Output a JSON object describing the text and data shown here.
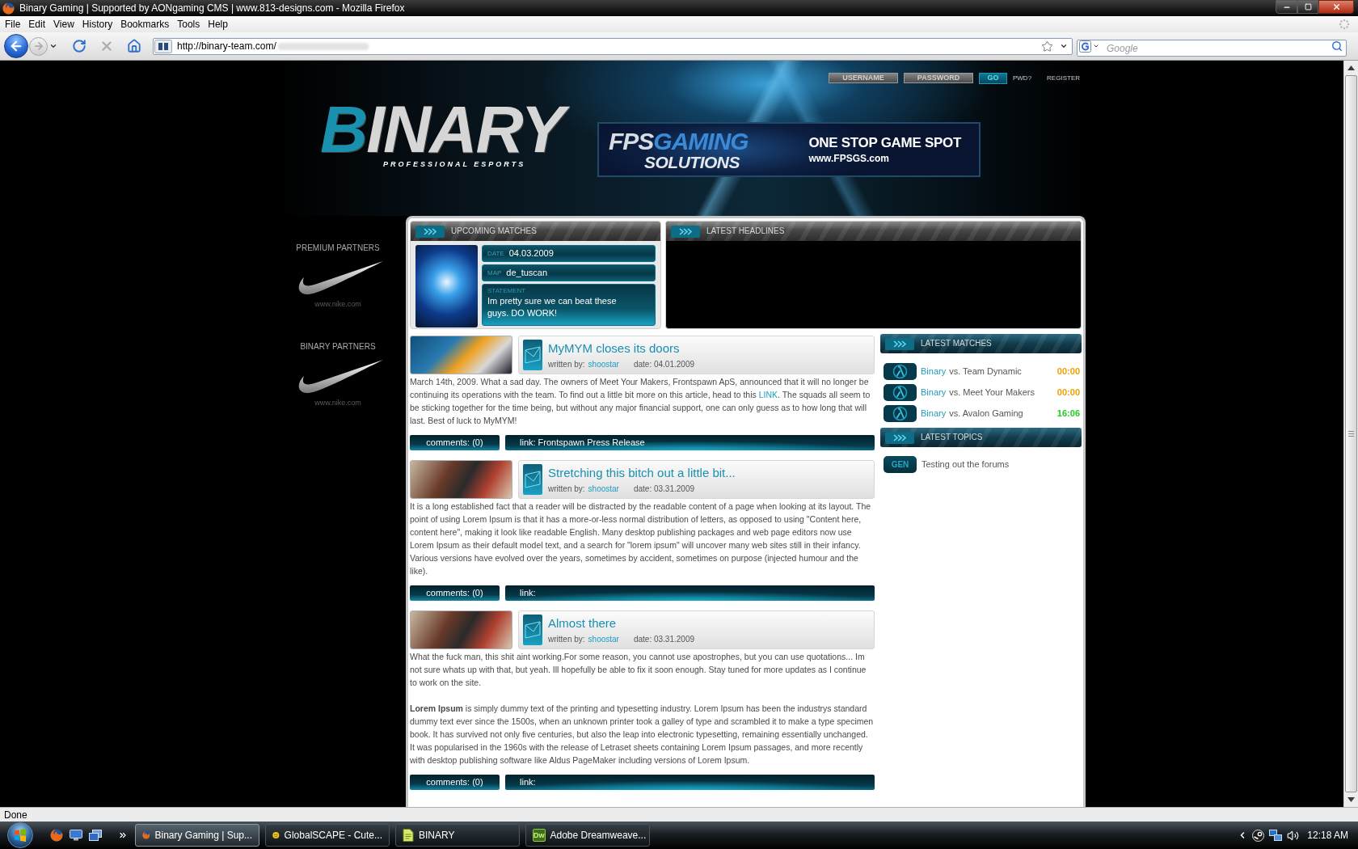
{
  "window": {
    "title": "Binary Gaming | Supported by AONgaming CMS | www.813-designs.com - Mozilla Firefox"
  },
  "menu": [
    "File",
    "Edit",
    "View",
    "History",
    "Bookmarks",
    "Tools",
    "Help"
  ],
  "nav_buttons": [
    {
      "kind": "back",
      "disabled": false
    },
    {
      "kind": "forward",
      "disabled": true
    },
    {
      "kind": "reload",
      "disabled": false
    },
    {
      "kind": "stop",
      "disabled": true
    },
    {
      "kind": "home",
      "disabled": false
    }
  ],
  "address_bar": {
    "value": "http://binary-team.com/"
  },
  "search_bar": {
    "placeholder": "Google"
  },
  "site": {
    "login": {
      "username_placeholder": "USERNAME",
      "password_placeholder": "PASSWORD",
      "submit": "GO",
      "links": [
        "PWD?",
        "REGISTER"
      ]
    },
    "logo": {
      "wordmark": "BINARY",
      "tagline": "PROFESSIONAL ESPORTS"
    },
    "banner": {
      "brand": "FPS",
      "brand_accent": "GAMING",
      "brand_sub": "SOLUTIONS",
      "slogan": "ONE STOP GAME SPOT",
      "url": "www.FPSGS.com"
    },
    "partners": [
      {
        "heading": "PREMIUM PARTNERS",
        "caption": "www.nike.com"
      },
      {
        "heading": "BINARY PARTNERS",
        "caption": "www.nike.com"
      }
    ],
    "upcoming_matches": {
      "title": "UPCOMING MATCHES",
      "fields": [
        {
          "kind": "inline",
          "label": "DATE",
          "value": "04.03.2009"
        },
        {
          "kind": "inline",
          "label": "MAP",
          "value": "de_tuscan"
        },
        {
          "kind": "block",
          "label": "STATEMENT",
          "value": "Im pretty sure we can beat these guys. DO WORK!"
        }
      ]
    },
    "latest_headlines": {
      "title": "LATEST HEADLINES"
    },
    "news": [
      {
        "title": "MyMYM closes its doors",
        "author_label": "written by:",
        "author": "shoostar",
        "date": "date: 04.01.2009",
        "paragraphs": [
          [
            {
              "kind": "text",
              "text": "March 14th, 2009. What a sad day. The owners of Meet Your Makers, Frontspawn ApS, announced that it will no longer be continuing its operations with the team. To find out a little bit more on this article, head to this "
            },
            {
              "kind": "link",
              "text": "LINK"
            },
            {
              "kind": "text",
              "text": ". The squads all seem to be sticking together for the time being, but without any major financial support, one can only guess as to how long that will last. Best of luck to MyMYM!"
            }
          ]
        ],
        "comments": "comments: (0)",
        "link": "link: Frontspawn Press Release"
      },
      {
        "title": "Stretching this bitch out a little bit...",
        "author_label": "written by:",
        "author": "shoostar",
        "date": "date: 03.31.2009",
        "paragraphs": [
          [
            {
              "kind": "text",
              "text": "It is a long established fact that a reader will be distracted by the readable content of a page when looking at its layout. The point of using Lorem Ipsum is that it has a more-or-less normal distribution of letters, as opposed to using \"Content here, content here\", making it look like readable English. Many desktop publishing packages and web page editors now use Lorem Ipsum as their default model text, and a search for \"lorem ipsum\" will uncover many web sites still in their infancy. Various versions have evolved over the years, sometimes by accident, sometimes on purpose (injected humour and the like)."
            }
          ]
        ],
        "comments": "comments: (0)",
        "link": "link:"
      },
      {
        "title": "Almost there",
        "author_label": "written by:",
        "author": "shoostar",
        "date": "date: 03.31.2009",
        "paragraphs": [
          [
            {
              "kind": "text",
              "text": "What the fuck man, this shit aint working.For some reason, you cannot use apostrophes, but you can use quotations... Im not sure whats up with that, but yeah. Ill hopefully be able to fix it soon enough. Stay tuned for more updates as I continue to work on the site."
            }
          ],
          [
            {
              "kind": "text",
              "text": "**Lorem Ipsum** is simply dummy text of the printing and typesetting industry. Lorem Ipsum has been the industrys standard dummy text ever since the 1500s, when an unknown printer took a galley of type and scrambled it to make a type specimen book. It has survived not only five centuries, but also the leap into electronic typesetting, remaining essentially unchanged. It was popularised in the 1960s with the release of Letraset sheets containing Lorem Ipsum passages, and more recently with desktop publishing software like Aldus PageMaker including versions of Lorem Ipsum."
            }
          ]
        ],
        "comments": "comments: (0)",
        "link": "link:"
      }
    ],
    "latest_matches": {
      "title": "LATEST MATCHES",
      "rows": [
        {
          "team": "Binary",
          "versus": "vs. Team Dynamic",
          "time": "00:00",
          "color": "#f0a000"
        },
        {
          "team": "Binary",
          "versus": "vs. Meet Your Makers",
          "time": "00:00",
          "color": "#f0a000"
        },
        {
          "team": "Binary",
          "versus": "vs. Avalon Gaming",
          "time": "16:06",
          "color": "#22cc22"
        }
      ]
    },
    "latest_topics": {
      "title": "LATEST TOPICS",
      "rows": [
        {
          "tag": "GEN",
          "title": "Testing out the forums"
        }
      ]
    }
  },
  "status_bar": {
    "text": "Done"
  },
  "taskbar": {
    "tasks": [
      {
        "kind": "firefox",
        "label": "Binary Gaming | Sup...",
        "selected": true
      },
      {
        "kind": "ftp",
        "label": "GlobalSCAPE - Cute...",
        "selected": false
      },
      {
        "kind": "document",
        "label": "BINARY",
        "selected": false
      },
      {
        "kind": "dreamweaver",
        "badge": "Dw",
        "label": "Adobe Dreamweave...",
        "selected": false
      }
    ],
    "clock": "12:18 AM"
  }
}
